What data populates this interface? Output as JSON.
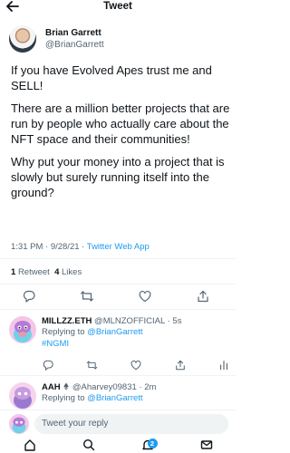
{
  "header": {
    "title": "Tweet"
  },
  "author": {
    "name": "Brian Garrett",
    "handle": "@BrianGarrett"
  },
  "tweet": {
    "paragraphs": [
      "If you have Evolved Apes trust me and SELL!",
      "There are a million better projects that are run by people who actually care about the NFT space and their communities!",
      "Why put your money into a project that is slowly but surely running itself into the ground?"
    ],
    "timestamp": "1:31 PM · 9/28/21 · ",
    "source": "Twitter Web App"
  },
  "stats": {
    "retweets": "1",
    "retweets_label": "Retweet",
    "likes": "4",
    "likes_label": "Likes"
  },
  "replies": [
    {
      "name": "MILLZZ.ETH",
      "handle": "@MLNZOFFICIAL",
      "time": "· 5s",
      "replying_prefix": "Replying to ",
      "replying_to": "@BrianGarrett",
      "text": "#NGMI"
    },
    {
      "name": "AAH",
      "handle": "@Aharvey09831",
      "time": "· 2m",
      "replying_prefix": "Replying to ",
      "replying_to": "@BrianGarrett"
    }
  ],
  "composer": {
    "placeholder": "Tweet your reply"
  },
  "tabbar": {
    "notifications_badge": "2"
  },
  "colors": {
    "accent": "#1d9bf0",
    "muted": "#536471",
    "text": "#0f1419"
  }
}
